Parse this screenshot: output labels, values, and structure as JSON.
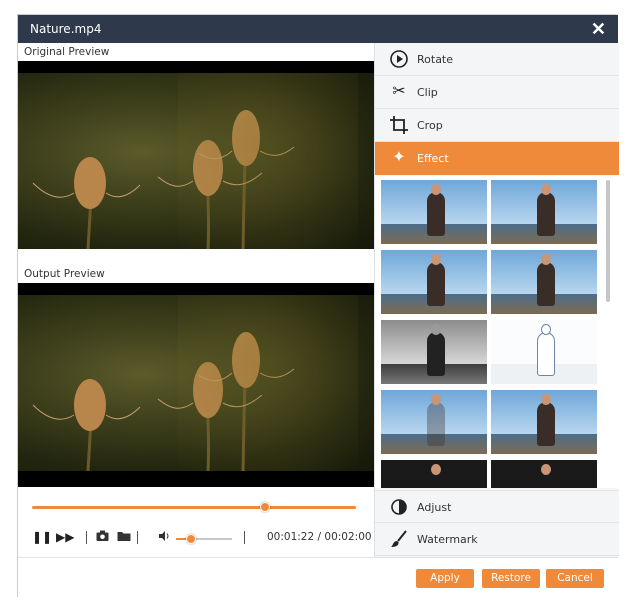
{
  "window": {
    "title": "Nature.mp4",
    "close_icon": "close-icon"
  },
  "preview": {
    "original_label": "Original Preview",
    "output_label": "Output Preview"
  },
  "player": {
    "progress_fraction": 0.72,
    "volume_fraction": 0.26,
    "current_time": "00:01:22",
    "separator": "/",
    "total_time": "00:02:00",
    "icons": [
      "pause-icon",
      "fast-forward-icon",
      "camera-icon",
      "folder-icon",
      "volume-icon"
    ]
  },
  "edit_menu": {
    "items": [
      {
        "label": "Rotate",
        "icon": "rotate-icon"
      },
      {
        "label": "Clip",
        "icon": "scissors-icon"
      },
      {
        "label": "Crop",
        "icon": "crop-icon"
      },
      {
        "label": "Effect",
        "icon": "sparkle-icon",
        "active": true
      }
    ],
    "bottom_items": [
      {
        "label": "Adjust",
        "icon": "adjust-icon"
      },
      {
        "label": "Watermark",
        "icon": "brush-icon"
      }
    ]
  },
  "effects": {
    "thumbnails": [
      "normal",
      "normal",
      "normal",
      "normal",
      "gray",
      "sketch",
      "soft",
      "normal",
      "dark",
      "dark"
    ]
  },
  "footer": {
    "apply_label": "Apply",
    "restore_label": "Restore",
    "cancel_label": "Cancel"
  },
  "colors": {
    "accent": "#ef8a3a",
    "titlebar": "#2e3a4b"
  }
}
